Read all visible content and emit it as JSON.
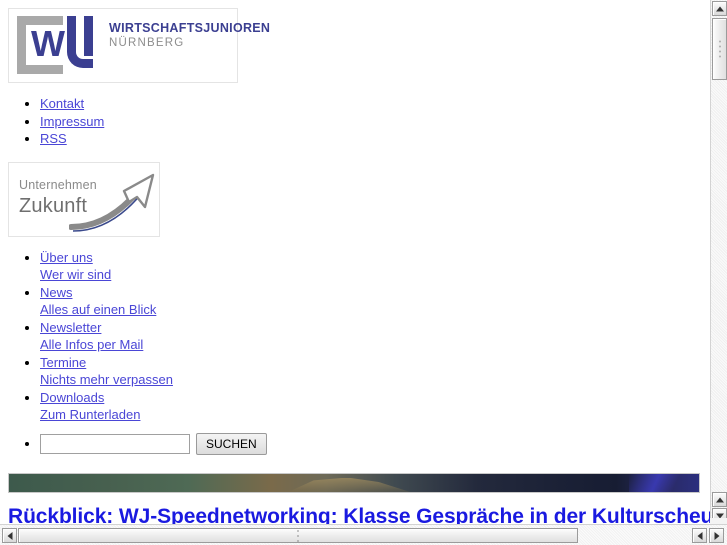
{
  "logo": {
    "mark_letter": "WJ",
    "line1": "WIRTSCHAFTSJUNIOREN",
    "line2": "NÜRNBERG",
    "bracket_color": "#a9a9a9",
    "brand_color": "#3b3f91",
    "subtitle_color": "#8d8d8d"
  },
  "meta_nav": {
    "items": [
      {
        "label": "Kontakt"
      },
      {
        "label": "Impressum"
      },
      {
        "label": "RSS"
      }
    ]
  },
  "partner_logo": {
    "line1": "Unternehmen",
    "line2": "Zukunft",
    "text_color": "#7a7a7a",
    "arrow_color": "#8a8a8a",
    "accent_color": "#3b4a8c"
  },
  "main_nav": {
    "items": [
      {
        "label": "Über uns",
        "sub": "Wer wir sind"
      },
      {
        "label": "News",
        "sub": "Alles auf einen Blick"
      },
      {
        "label": "Newsletter",
        "sub": "Alle Infos per Mail"
      },
      {
        "label": "Termine",
        "sub": "Nichts mehr verpassen"
      },
      {
        "label": "Downloads",
        "sub": "Zum Runterladen"
      }
    ]
  },
  "search": {
    "value": "",
    "placeholder": "",
    "button_label": "SUCHEN"
  },
  "hero": {
    "image_alt": "panorama photo strip",
    "colors": [
      "#3d5a4c",
      "#7a6a4a",
      "#23293c",
      "#2b2f7e"
    ]
  },
  "article": {
    "headline": "Rückblick: WJ-Speednetworking: Klasse Gespräche in der Kulturscheune",
    "link_color": "#1a1ae0"
  },
  "scrollbars": {
    "vertical": {
      "up_icon": "triangle-up-icon",
      "down_icon": "triangle-down-icon",
      "position_percent": 3
    },
    "horizontal": {
      "left_icon": "triangle-left-icon",
      "right_icon": "triangle-right-icon",
      "position_percent": 0
    }
  },
  "link_color": "#4a46d6"
}
